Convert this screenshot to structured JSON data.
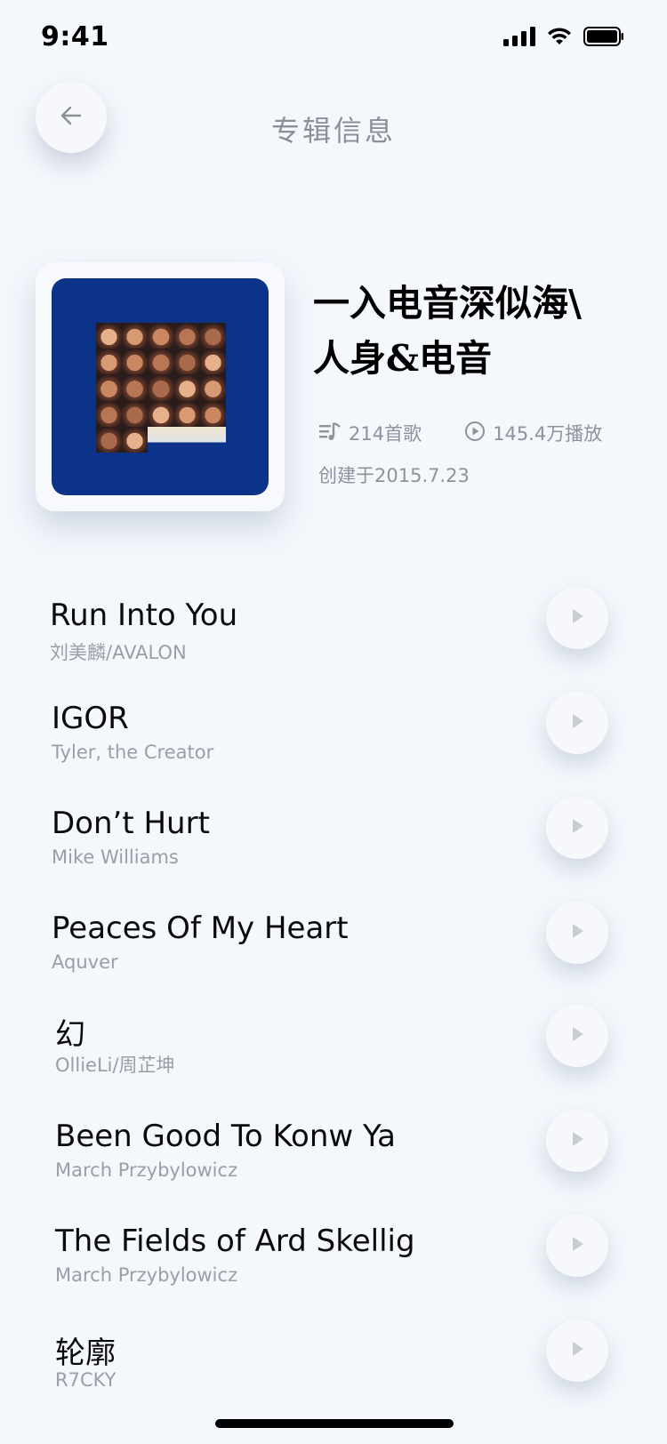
{
  "status_bar": {
    "time": "9:41"
  },
  "header": {
    "title": "专辑信息",
    "back_icon": "arrow-left-icon"
  },
  "album": {
    "title_line1": "一入电音深似海\\",
    "title_line2": "人身&电音",
    "song_count": "214首歌",
    "play_count": "145.4万播放",
    "created": "创建于2015.7.23",
    "cover_bg_color": "#0b3389"
  },
  "songs": [
    {
      "title": "Run Into You",
      "artist": "刘美麟/AVALON"
    },
    {
      "title": "IGOR",
      "artist": "Tyler, the Creator"
    },
    {
      "title": "Don’t Hurt",
      "artist": "Mike Williams"
    },
    {
      "title": "Peaces Of My Heart",
      "artist": "Aquver"
    },
    {
      "title": "幻",
      "artist": "OllieLi/周芷坤"
    },
    {
      "title": "Been Good To Konw Ya",
      "artist": "March Przybylowicz"
    },
    {
      "title": "The Fields of Ard Skellig",
      "artist": "March Przybylowicz"
    },
    {
      "title": "轮廓",
      "artist": "R7CKY"
    }
  ]
}
